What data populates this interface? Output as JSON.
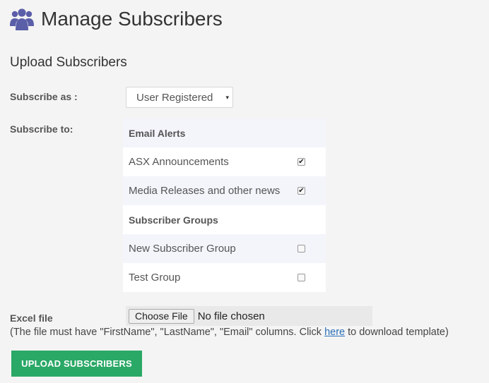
{
  "header": {
    "title": "Manage Subscribers",
    "icon": "users-icon",
    "icon_color": "#5b5fa8"
  },
  "section_title": "Upload Subscribers",
  "subscribe_as": {
    "label": "Subscribe as :",
    "selected": "User Registered",
    "caret": "▾"
  },
  "subscribe_to": {
    "label": "Subscribe to:",
    "groups": [
      {
        "heading": "Email Alerts",
        "items": [
          {
            "label": "ASX Announcements",
            "checked": true
          },
          {
            "label": "Media Releases and other news",
            "checked": true
          }
        ]
      },
      {
        "heading": "Subscriber Groups",
        "items": [
          {
            "label": "New Subscriber Group",
            "checked": false
          },
          {
            "label": "Test Group",
            "checked": false
          }
        ]
      }
    ]
  },
  "excel": {
    "label": "Excel file",
    "button": "Choose File",
    "status": "No file chosen",
    "hint_before": "(The file must have \"FirstName\", \"LastName\", \"Email\" columns. Click ",
    "hint_link": "here",
    "hint_after": " to download template)"
  },
  "upload_button": "UPLOAD SUBSCRIBERS",
  "colors": {
    "accent_green": "#2aa866",
    "link_blue": "#2a6fb8"
  }
}
